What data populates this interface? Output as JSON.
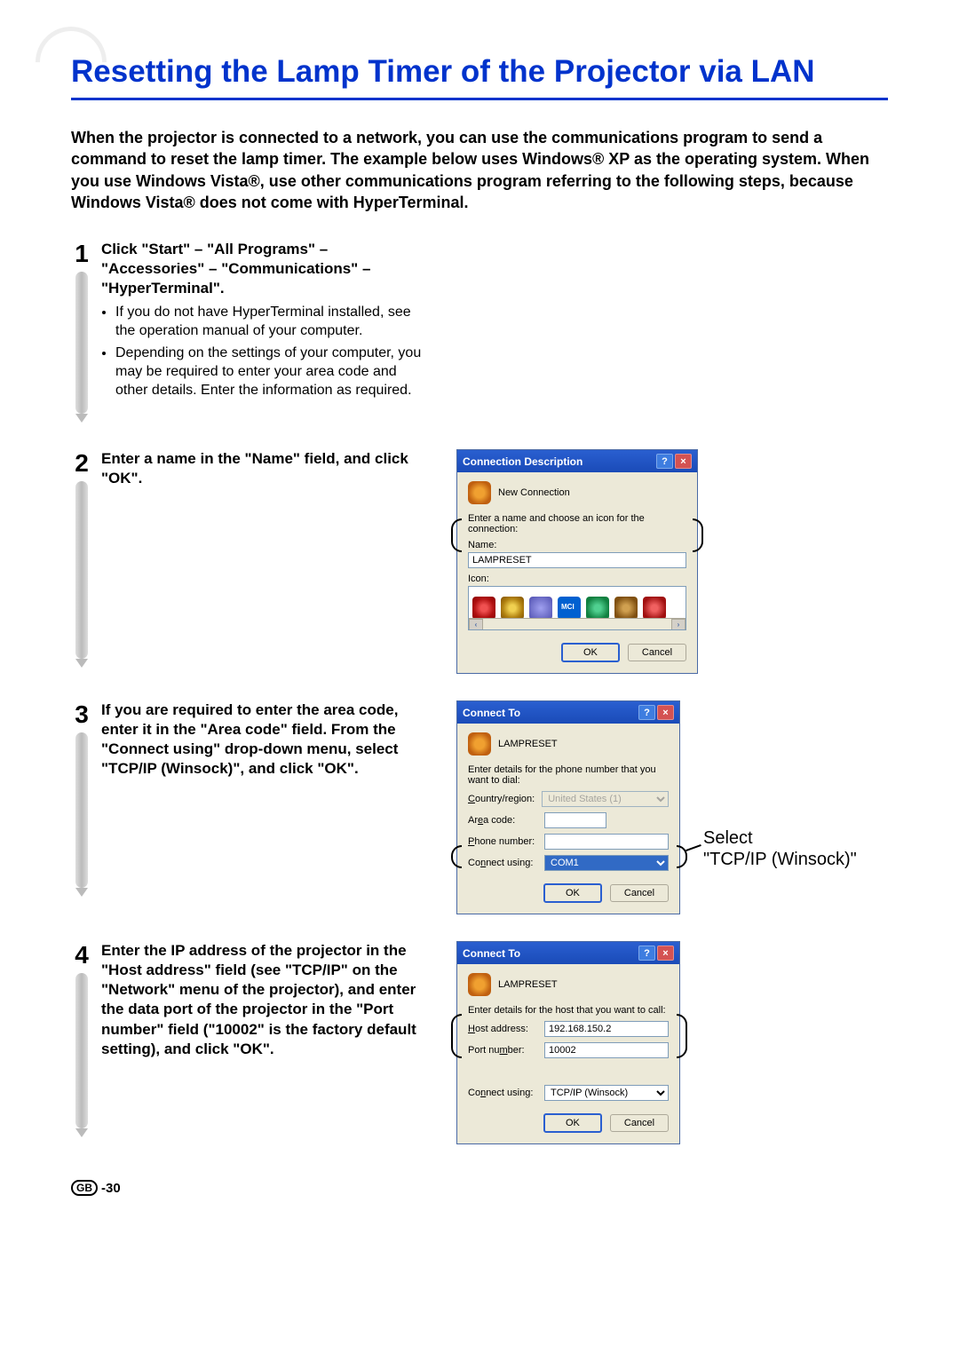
{
  "title": "Resetting the Lamp Timer of the Projector via LAN",
  "intro": "When the projector is connected to a network, you can use the communications program to send a command to reset the lamp timer. The example below uses Windows® XP as the operating system. When you use Windows Vista®, use other communications program referring to the following steps, because Windows Vista® does not come with HyperTerminal.",
  "steps": {
    "s1": {
      "num": "1",
      "head": "Click \"Start\" – \"All Programs\" – \"Accessories\" – \"Communications\" – \"HyperTerminal\".",
      "bul1": "If you do not have HyperTerminal installed, see the operation manual of your computer.",
      "bul2": "Depending on the settings of your computer, you may be required to enter your area code and other details. Enter the information as required."
    },
    "s2": {
      "num": "2",
      "head": "Enter a name in the \"Name\" field, and click \"OK\"."
    },
    "s3": {
      "num": "3",
      "head": "If you are required to enter the area code, enter it in the \"Area code\" field. From the \"Connect using\" drop-down menu, select \"TCP/IP (Winsock)\", and click \"OK\"."
    },
    "s4": {
      "num": "4",
      "head": "Enter the IP address of the projector in the \"Host address\" field (see \"TCP/IP\" on the \"Network\" menu of the projector), and enter the data port of the projector  in the \"Port number\" field (\"10002\" is the factory default setting), and click \"OK\"."
    }
  },
  "dlg1": {
    "title": "Connection Description",
    "subtitle": "New Connection",
    "prompt": "Enter a name and choose an icon for the connection:",
    "name_label": "Name:",
    "name_value": "LAMPRESET",
    "icon_label": "Icon:",
    "ok": "OK",
    "cancel": "Cancel"
  },
  "dlg2": {
    "title": "Connect To",
    "subtitle": "LAMPRESET",
    "prompt": "Enter details for the phone number that you want to dial:",
    "country_label": "Country/region:",
    "country_value": "United States (1)",
    "area_label": "Area code:",
    "phone_label": "Phone number:",
    "connect_label": "Connect using:",
    "connect_value": "COM1",
    "ok": "OK",
    "cancel": "Cancel",
    "annot1": "Select",
    "annot2": "\"TCP/IP (Winsock)\""
  },
  "dlg3": {
    "title": "Connect To",
    "subtitle": "LAMPRESET",
    "prompt": "Enter details for the host that you want to call:",
    "host_label": "Host address:",
    "host_value": "192.168.150.2",
    "port_label": "Port number:",
    "port_value": "10002",
    "connect_label": "Connect using:",
    "connect_value": "TCP/IP (Winsock)",
    "ok": "OK",
    "cancel": "Cancel"
  },
  "footer": {
    "gb": "GB",
    "page": "-30"
  }
}
